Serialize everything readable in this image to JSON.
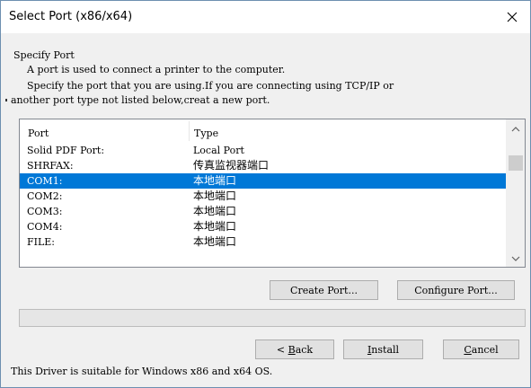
{
  "window": {
    "title": "Select Port (x86/x64)",
    "close_icon": "close-icon"
  },
  "intro": {
    "heading": "Specify Port",
    "line1": "A port is used to connect a printer to the computer.",
    "line2": "Specify the port that you are using.If you are connecting using TCP/IP or",
    "line3": "another port type not listed below,creat a new port."
  },
  "port_list": {
    "columns": [
      "Port",
      "Type"
    ],
    "rows": [
      {
        "port": "Solid PDF Port:",
        "type": "Local Port",
        "selected": false
      },
      {
        "port": "SHRFAX:",
        "type": "传真监视器端口",
        "selected": false
      },
      {
        "port": "COM1:",
        "type": "本地端口",
        "selected": true
      },
      {
        "port": "COM2:",
        "type": "本地端口",
        "selected": false
      },
      {
        "port": "COM3:",
        "type": "本地端口",
        "selected": false
      },
      {
        "port": "COM4:",
        "type": "本地端口",
        "selected": false
      },
      {
        "port": "FILE:",
        "type": "本地端口",
        "selected": false
      }
    ],
    "selection_color": "#0078d7",
    "scroll_up_icon": "chevron-up-icon",
    "scroll_down_icon": "chevron-down-icon"
  },
  "actions": {
    "create_port": "Create Port...",
    "configure_port": "Configure Port..."
  },
  "progress": {
    "value": 0,
    "fill_color": "#06b025"
  },
  "nav": {
    "back_prefix": "< ",
    "back_accel": "B",
    "back_rest": "ack",
    "install_accel": "I",
    "install_rest": "nstall",
    "cancel_accel": "C",
    "cancel_rest": "ancel"
  },
  "footer": {
    "text": "This Driver is suitable for Windows x86 and x64 OS."
  }
}
